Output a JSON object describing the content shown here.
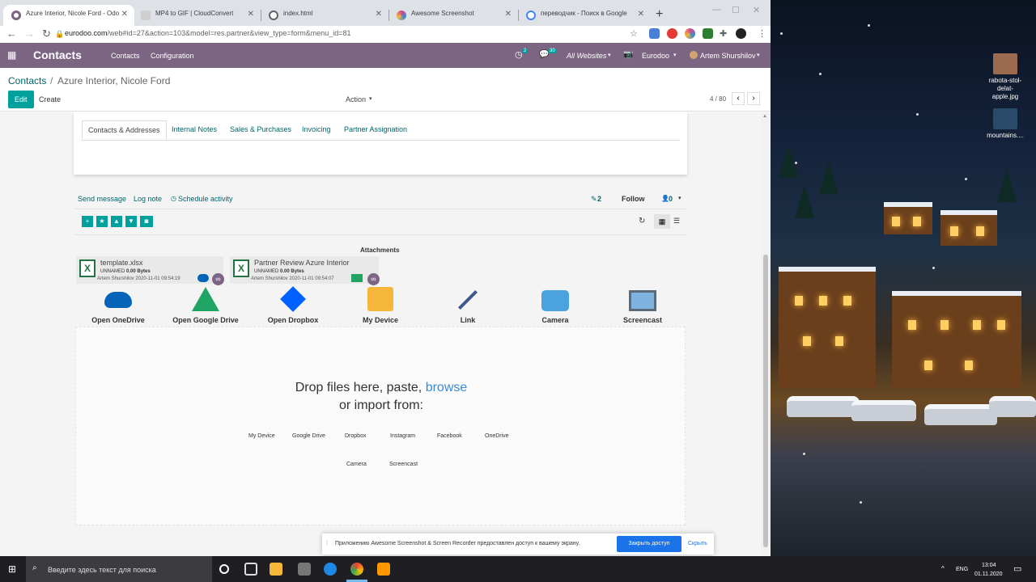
{
  "browser": {
    "tabs": [
      {
        "title": "Azure Interior, Nicole Ford - Odo",
        "active": true,
        "favicon_color": "#7c6583"
      },
      {
        "title": "MP4 to GIF | CloudConvert",
        "active": false,
        "favicon_color": "#cfcfcf"
      },
      {
        "title": "index.html",
        "active": false,
        "favicon_color": "#5f6368"
      },
      {
        "title": "Awesome Screenshot",
        "active": false,
        "favicon_color": "#d64a8a"
      },
      {
        "title": "переводчик - Поиск в Google",
        "active": false,
        "favicon_color": "#4285f4"
      }
    ],
    "new_tab": "+",
    "url_host": "eurodoo.com",
    "url_path": "/web#id=27&action=103&model=res.partner&view_type=form&menu_id=81"
  },
  "odoo": {
    "app_title": "Contacts",
    "menu": [
      "Contacts",
      "Configuration"
    ],
    "activity_count": "2",
    "message_count": "30",
    "websites": "All Websites",
    "company": "Eurodoo",
    "user": "Artem Shurshilov",
    "breadcrumb_root": "Contacts",
    "breadcrumb_sep": "/",
    "breadcrumb_current": "Azure Interior, Nicole Ford",
    "edit": "Edit",
    "create": "Create",
    "action": "Action",
    "pager": "4 / 80"
  },
  "notebook_tabs": [
    "Contacts & Addresses",
    "Internal Notes",
    "Sales & Purchases",
    "Invoicing",
    "Partner Assignation"
  ],
  "chatter": {
    "send_message": "Send message",
    "log_note": "Log note",
    "schedule_activity": "Schedule activity",
    "attachment_count": "2",
    "follow": "Follow",
    "followers": "0",
    "attachments_title": "Attachments"
  },
  "attachments": [
    {
      "name": "template.xlsx",
      "owner": "UNNAMED",
      "size": "0.00 Bytes",
      "meta": "Artem Shurshilov 2020-11-01 09:54:19"
    },
    {
      "name": "Partner Review Azure Interior",
      "owner": "UNNAMED",
      "size": "0.00 Bytes",
      "meta": "Artem Shurshilov 2020-11-01 09:54:07"
    }
  ],
  "sources": [
    {
      "label": "Open OneDrive",
      "icon": "onedrive-icon",
      "color": "#0364b8"
    },
    {
      "label": "Open Google Drive",
      "icon": "google-drive-icon",
      "color": "#1fa463"
    },
    {
      "label": "Open Dropbox",
      "icon": "dropbox-icon",
      "color": "#0061ff"
    },
    {
      "label": "My Device",
      "icon": "folder-icon",
      "color": "#f5b63a"
    },
    {
      "label": "Link",
      "icon": "link-icon",
      "color": "#3c5a8a"
    },
    {
      "label": "Camera",
      "icon": "camera-icon",
      "color": "#4aa3df"
    },
    {
      "label": "Screencast",
      "icon": "monitor-icon",
      "color": "#5c6b7a"
    }
  ],
  "dropzone": {
    "line1": "Drop files here, paste,",
    "browse": "browse",
    "line2": "or import from:",
    "row1": [
      "My Device",
      "Google Drive",
      "Dropbox",
      "Instagram",
      "Facebook",
      "OneDrive"
    ],
    "row2": [
      "Camera",
      "Screencast"
    ]
  },
  "notification": {
    "message": "Приложению Awesome Screenshot & Screen Recorder предоставлен доступ к вашему экрану.",
    "accept": "Закрыть доступ",
    "hide": "Скрыть"
  },
  "desktop": {
    "icons": [
      {
        "label": "rabota-stol-delat-apple.jpg"
      },
      {
        "label": "mountains...."
      }
    ]
  },
  "taskbar": {
    "search_placeholder": "Введите здесь текст для поиска",
    "lang": "ENG",
    "time": "13:04",
    "date": "01.11.2020"
  }
}
